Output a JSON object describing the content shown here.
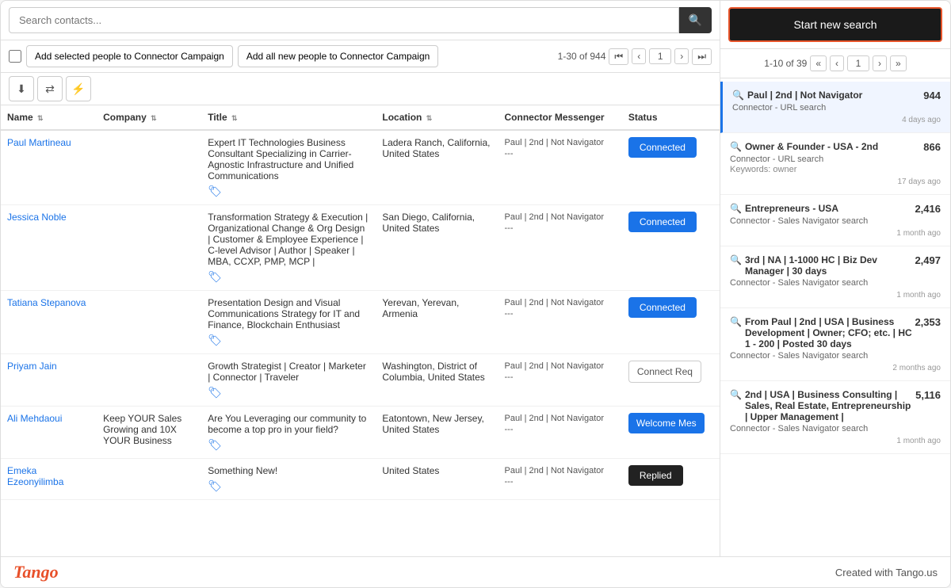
{
  "search": {
    "placeholder": "Search contacts...",
    "btn_icon": "🔍"
  },
  "toolbar": {
    "add_selected_label": "Add selected people to Connector Campaign",
    "add_all_label": "Add all new people to Connector Campaign",
    "pagination_text": "1-30 of 944",
    "page_number": "1"
  },
  "icon_tools": [
    {
      "name": "download-icon",
      "symbol": "⬇"
    },
    {
      "name": "shuffle-icon",
      "symbol": "⇄"
    },
    {
      "name": "filter-icon",
      "symbol": "⚡"
    }
  ],
  "table": {
    "headers": [
      {
        "key": "name",
        "label": "Name",
        "sort": true
      },
      {
        "key": "company",
        "label": "Company",
        "sort": true
      },
      {
        "key": "title",
        "label": "Title",
        "sort": true
      },
      {
        "key": "location",
        "label": "Location",
        "sort": true
      },
      {
        "key": "connector",
        "label": "Connector Messenger"
      },
      {
        "key": "status",
        "label": "Status"
      }
    ],
    "rows": [
      {
        "name": "Paul Martineau",
        "company": "",
        "title": "Expert IT Technologies Business Consultant Specializing in Carrier-Agnostic Infrastructure and Unified Communications",
        "location": "Ladera Ranch, California, United States",
        "connector": "Paul | 2nd | Not Navigator",
        "connector_extra": "---",
        "status_type": "connected",
        "status_label": "Connected",
        "tag": true
      },
      {
        "name": "Jessica Noble",
        "company": "",
        "title": "Transformation Strategy & Execution | Organizational Change & Org Design | Customer & Employee Experience | C-level Advisor | Author | Speaker | MBA, CCXP, PMP, MCP |",
        "location": "San Diego, California, United States",
        "connector": "Paul | 2nd | Not Navigator",
        "connector_extra": "---",
        "status_type": "connected",
        "status_label": "Connected",
        "tag": true
      },
      {
        "name": "Tatiana Stepanova",
        "company": "",
        "title": "Presentation Design and Visual Communications Strategy for IT and Finance, Blockchain Enthusiast",
        "location": "Yerevan, Yerevan, Armenia",
        "connector": "Paul | 2nd | Not Navigator",
        "connector_extra": "---",
        "status_type": "connected",
        "status_label": "Connected",
        "tag": true
      },
      {
        "name": "Priyam Jain",
        "company": "",
        "title": "Growth Strategist | Creator | Marketer | Connector | Traveler",
        "location": "Washington, District of Columbia, United States",
        "connector": "Paul | 2nd | Not Navigator",
        "connector_extra": "---",
        "status_type": "connect_req",
        "status_label": "Connect Req",
        "tag": true
      },
      {
        "name": "Ali Mehdaoui",
        "company": "Keep YOUR Sales Growing and 10X YOUR Business",
        "title": "Are You Leveraging our community to become a top pro in your field?",
        "location": "Eatontown, New Jersey, United States",
        "connector": "Paul | 2nd | Not Navigator",
        "connector_extra": "---",
        "status_type": "welcome",
        "status_label": "Welcome Mes",
        "tag": true
      },
      {
        "name": "Emeka Ezeonyilimba",
        "company": "",
        "title": "Something New!",
        "location": "United States",
        "connector": "Paul | 2nd | Not Navigator",
        "connector_extra": "---",
        "status_type": "replied",
        "status_label": "Replied",
        "tag": true
      }
    ]
  },
  "right_panel": {
    "new_search_label": "Start new search",
    "pagination": {
      "text": "1-10 of 39",
      "page": "1"
    },
    "searches": [
      {
        "title": "Paul | 2nd | Not Navigator",
        "count": "944",
        "sub": "Connector - URL search",
        "detail": "",
        "time": "4 days ago",
        "active": true
      },
      {
        "title": "Owner & Founder - USA - 2nd",
        "count": "866",
        "sub": "Connector - URL search",
        "detail": "Keywords: owner",
        "time": "17 days ago",
        "active": false
      },
      {
        "title": "Entrepreneurs - USA",
        "count": "2,416",
        "sub": "Connector - Sales Navigator search",
        "detail": "",
        "time": "1 month ago",
        "active": false
      },
      {
        "title": "3rd | NA | 1-1000 HC | Biz Dev Manager | 30 days",
        "count": "2,497",
        "sub": "Connector - Sales Navigator search",
        "detail": "",
        "time": "1 month ago",
        "active": false
      },
      {
        "title": "From Paul | 2nd | USA | Business Development | Owner; CFO; etc. | HC 1 - 200 | Posted 30 days",
        "count": "2,353",
        "sub": "Connector - Sales Navigator search",
        "detail": "",
        "time": "2 months ago",
        "active": false
      },
      {
        "title": "2nd | USA | Business Consulting | Sales, Real Estate, Entrepreneurship | Upper Management |",
        "count": "5,116",
        "sub": "Connector - Sales Navigator search",
        "detail": "",
        "time": "1 month ago",
        "active": false
      }
    ]
  },
  "footer": {
    "logo": "Tango",
    "credit": "Created with Tango.us"
  }
}
